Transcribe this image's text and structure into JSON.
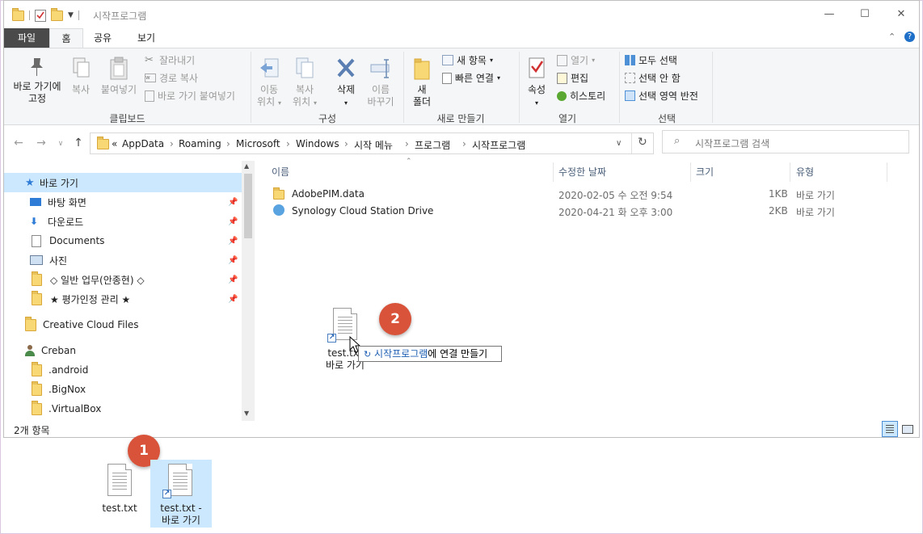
{
  "window": {
    "title": "시작프로그램",
    "controls": {
      "minimize": "—",
      "maximize": "☐",
      "close": "✕"
    }
  },
  "ribbon_tabs": [
    "파일",
    "홈",
    "공유",
    "보기"
  ],
  "ribbon": {
    "clipboard": {
      "pin_label_1": "바로 가기에",
      "pin_label_2": "고정",
      "copy": "복사",
      "paste": "붙여넣기",
      "cut": "잘라내기",
      "copy_path": "경로 복사",
      "paste_shortcut": "바로 가기 붙여넣기",
      "group": "클립보드"
    },
    "organize": {
      "move_1": "이동",
      "move_2": "위치",
      "copyto_1": "복사",
      "copyto_2": "위치",
      "delete": "삭제",
      "rename_1": "이름",
      "rename_2": "바꾸기",
      "group": "구성"
    },
    "new": {
      "new_folder_1": "새",
      "new_folder_2": "폴더",
      "new_item": "새 항목",
      "easy_access": "빠른 연결",
      "group": "새로 만들기"
    },
    "open": {
      "properties": "속성",
      "open": "열기",
      "edit": "편집",
      "history": "히스토리",
      "group": "열기"
    },
    "select": {
      "select_all": "모두 선택",
      "select_none": "선택 안 함",
      "invert": "선택 영역 반전",
      "group": "선택"
    }
  },
  "address": {
    "overflow": "«",
    "crumbs": [
      "AppData",
      "Roaming",
      "Microsoft",
      "Windows",
      "시작 메뉴",
      "프로그램",
      "시작프로그램"
    ],
    "search_placeholder": "시작프로그램 검색"
  },
  "nav": {
    "quick_access": "바로 가기",
    "pinned": [
      "바탕 화면",
      "다운로드",
      "Documents",
      "사진",
      "◇ 일반 업무(안종현) ◇",
      "★ 평가인정 관리 ★"
    ],
    "creative_cloud": "Creative Cloud Files",
    "user": "Creban",
    "user_folders": [
      ".android",
      ".BigNox",
      ".VirtualBox"
    ]
  },
  "columns": {
    "name": "이름",
    "modified": "수정한 날짜",
    "size": "크기",
    "type": "유형"
  },
  "files": [
    {
      "name": "AdobePIM.data",
      "modified": "2020-02-05 수 오전 9:54",
      "size": "1KB",
      "type": "바로 가기"
    },
    {
      "name": "Synology Cloud Station Drive",
      "modified": "2020-04-21 화 오후 3:00",
      "size": "2KB",
      "type": "바로 가기"
    }
  ],
  "status": {
    "count": "2개 항목"
  },
  "drag": {
    "label_1": "test.txt",
    "label_2": "바로 가기",
    "tooltip_target": "시작프로그램",
    "tooltip_action": "에 연결 만들기"
  },
  "desktop": {
    "file1": "test.txt",
    "file2_line1": "test.txt -",
    "file2_line2": "바로 가기"
  },
  "badges": {
    "one": "1",
    "two": "2"
  },
  "colors": {
    "badge": "#d8533a",
    "selection": "#cce8ff",
    "accent": "#1e5fb3"
  }
}
